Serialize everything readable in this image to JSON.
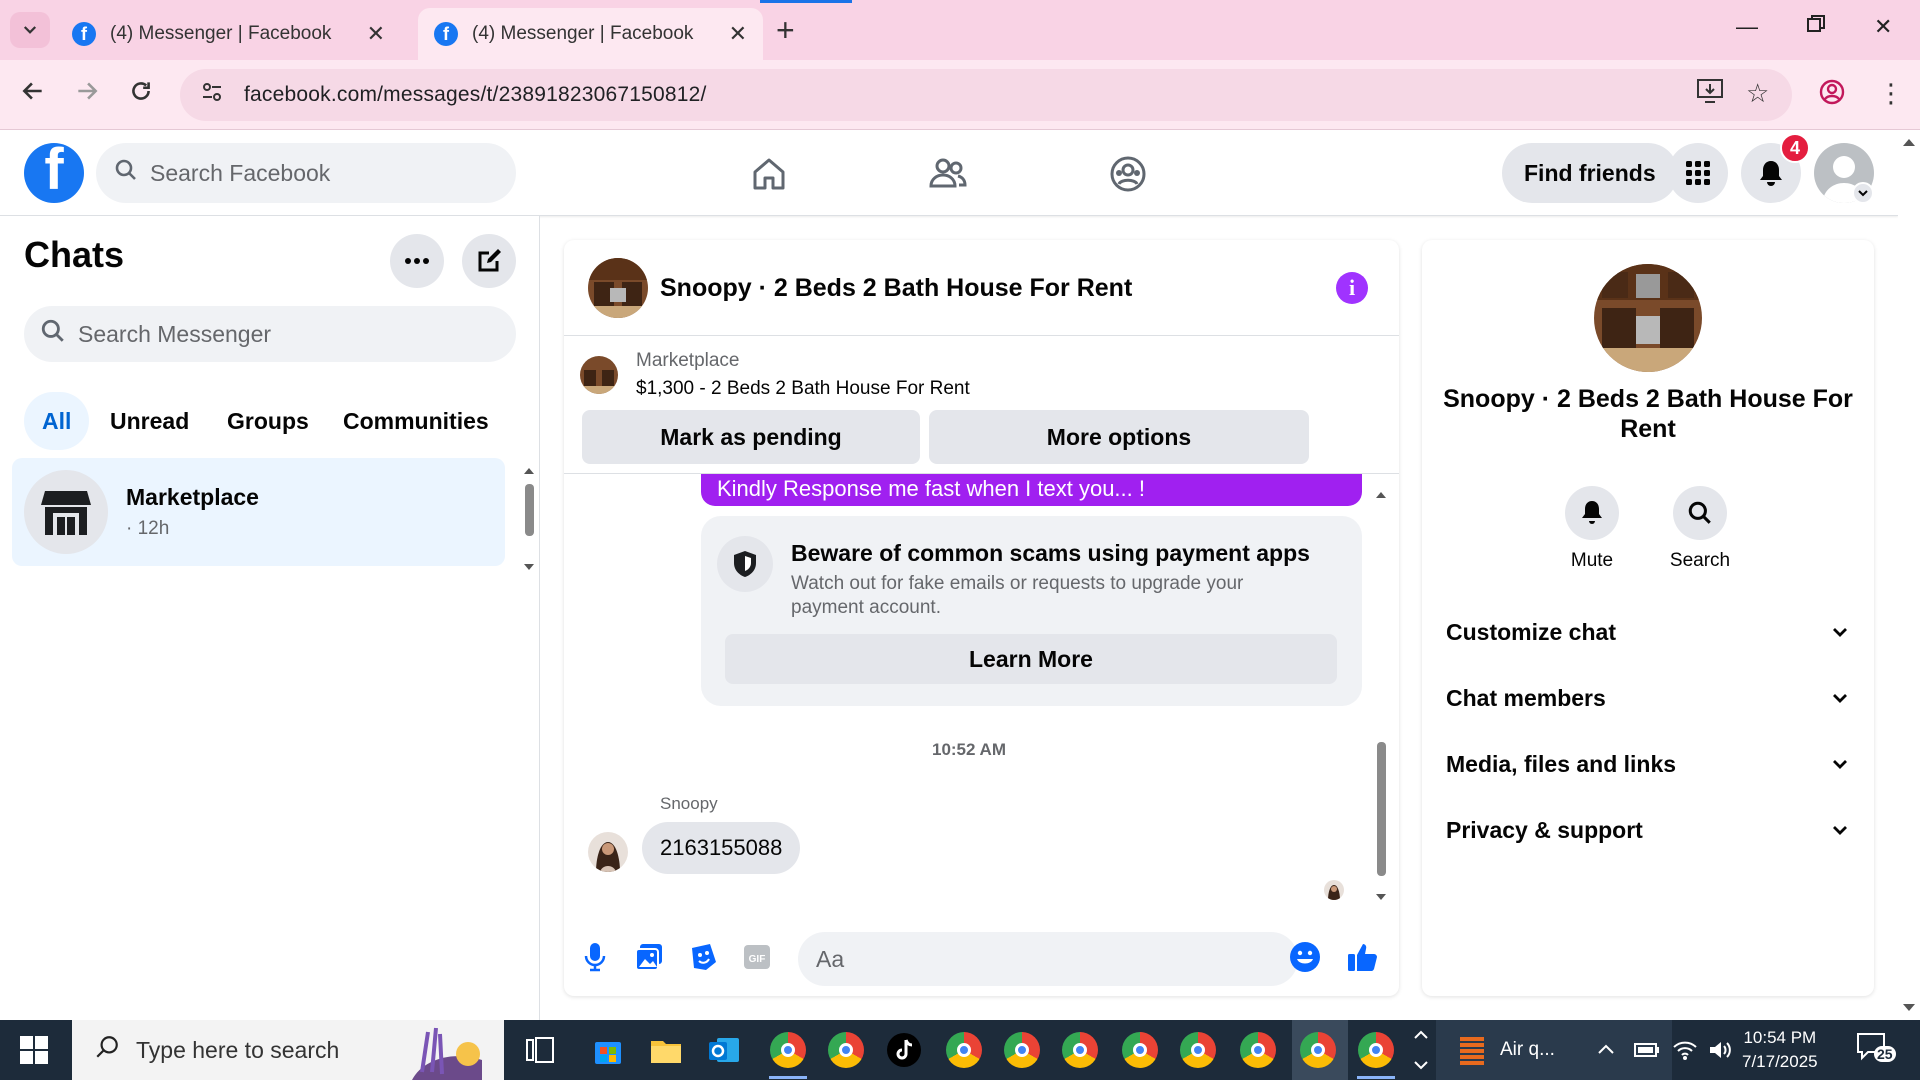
{
  "browser": {
    "tabs": [
      {
        "title": "(4) Messenger | Facebook",
        "active": false
      },
      {
        "title": "(4) Messenger | Facebook",
        "active": true
      }
    ],
    "url": "facebook.com/messages/t/23891823067150812/"
  },
  "fb_header": {
    "search_placeholder": "Search Facebook",
    "find_friends": "Find friends",
    "notification_count": "4"
  },
  "left": {
    "title": "Chats",
    "search_placeholder": "Search Messenger",
    "filters": [
      "All",
      "Unread",
      "Groups",
      "Communities"
    ],
    "selected_filter": "All",
    "chats": [
      {
        "name": "Marketplace",
        "time": "· 12h"
      }
    ]
  },
  "conversation": {
    "title": "Snoopy · 2 Beds 2 Bath House For Rent",
    "listing": {
      "label": "Marketplace",
      "price_title": "$1,300 - 2 Beds 2 Bath House For Rent",
      "btn_pending": "Mark as pending",
      "btn_more": "More options"
    },
    "partial_message": "Kindly Response me fast when I text you... !",
    "scam_notice": {
      "title": "Beware of common scams using payment apps",
      "body": "Watch out for fake emails or requests to upgrade your payment account.",
      "button": "Learn More"
    },
    "timestamp": "10:52 AM",
    "sender_name": "Snoopy",
    "message": "2163155088",
    "composer_placeholder": "Aa"
  },
  "details": {
    "name": "Snoopy · 2 Beds 2 Bath House For Rent",
    "actions": [
      "Mute",
      "Search"
    ],
    "sections": [
      "Customize chat",
      "Chat members",
      "Media, files and links",
      "Privacy & support"
    ]
  },
  "taskbar": {
    "search_placeholder": "Type here to search",
    "weather": "Air q...",
    "time": "10:54 PM",
    "date": "7/17/2025",
    "notif_count": "25"
  },
  "colors": {
    "fb_blue": "#1877f2",
    "accent_purple": "#a020f0",
    "tab_bg": "#f9d3e5",
    "badge_red": "#e41e3f"
  }
}
